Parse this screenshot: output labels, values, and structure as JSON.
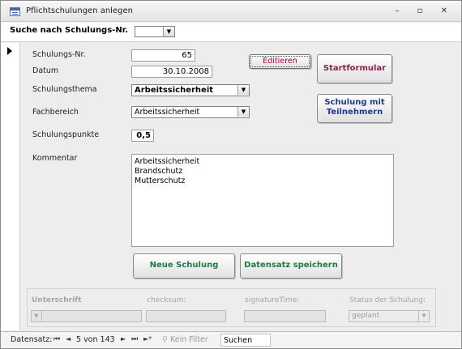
{
  "window": {
    "title": "Pflichtschulungen anlegen",
    "minimize": "–",
    "restore": "▫",
    "close": "✕"
  },
  "header": {
    "search_label": "Suche nach Schulungs-Nr.",
    "search_value": ""
  },
  "form": {
    "schulungs_nr_label": "Schulungs-Nr.",
    "schulungs_nr_value": "65",
    "datum_label": "Datum",
    "datum_value": "30.10.2008",
    "thema_label": "Schulungsthema",
    "thema_value": "Arbeitssicherheit",
    "fachbereich_label": "Fachbereich",
    "fachbereich_value": "Arbeitssicherheit",
    "punkte_label": "Schulungspunkte",
    "punkte_value": "0,5",
    "kommentar_label": "Kommentar",
    "kommentar_lines": [
      "Arbeitssicherheit",
      "Brandschutz",
      "Mutterschutz"
    ]
  },
  "buttons": {
    "editieren": "Editieren",
    "startformular": "Startformular",
    "schulung_mit_teilnehmern_line1": "Schulung mit",
    "schulung_mit_teilnehmern_line2": "Teilnehmern",
    "neue_schulung": "Neue Schulung",
    "datensatz_speichern": "Datensatz speichern"
  },
  "subform": {
    "unterschrift_label": "Unterschrift",
    "checksum_label": "checksum:",
    "signature_time_label": "signatureTime:",
    "status_label": "Status der Schulung:",
    "status_value": "geplant"
  },
  "navigation": {
    "datensatz_label": "Datensatz:",
    "first": "⏮",
    "prev": "◄",
    "record_text": "5 von 143",
    "next": "►",
    "last": "⏭",
    "new": "►*",
    "filter_label": "Kein Filter",
    "search_label": "Suchen"
  },
  "colors": {
    "accent_red": "#b0003a",
    "accent_blue": "#1f3c88",
    "accent_green": "#1e7a45"
  }
}
